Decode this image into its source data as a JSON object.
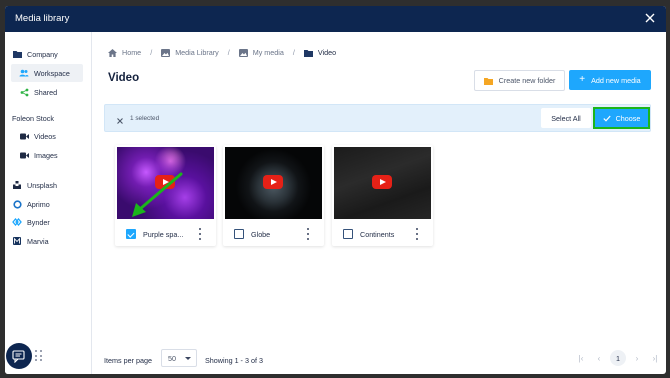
{
  "modal": {
    "title": "Media library"
  },
  "sidebar": {
    "company": "Company",
    "workspace": "Workspace",
    "shared": "Shared",
    "foleon_stock": "Foleon Stock",
    "videos": "Videos",
    "images": "Images",
    "unsplash": "Unsplash",
    "aprimo": "Aprimo",
    "bynder": "Bynder",
    "marvia": "Marvia"
  },
  "breadcrumb": [
    "Home",
    "Media Library",
    "My media",
    "Video"
  ],
  "page": {
    "title": "Video"
  },
  "actions": {
    "create_folder": "Create new folder",
    "add_media": "Add new media"
  },
  "selection": {
    "count": "1 selected",
    "select_all": "Select All",
    "choose": "Choose"
  },
  "media_items": [
    {
      "name": "Purple spa...",
      "checked": true
    },
    {
      "name": "Globe",
      "checked": false
    },
    {
      "name": "Continents",
      "checked": false
    }
  ],
  "footer": {
    "items_per_page_label": "Items per page",
    "items_per_page_value": "50",
    "showing": "Showing 1 - 3 of 3",
    "current_page": "1"
  },
  "colors": {
    "header": "#0d2650",
    "accent": "#1ea7fd",
    "choose_outline": "#1bb51b",
    "annotation_arrow": "#1bb51b",
    "folder_icon": "#f5a623",
    "youtube": "#e62117"
  },
  "icons": {
    "close": "close-icon",
    "folder": "folder-icon",
    "home": "home-icon",
    "users": "users-icon",
    "share": "share-icon",
    "video": "video-icon",
    "image": "image-icon",
    "chat": "chat-icon"
  }
}
